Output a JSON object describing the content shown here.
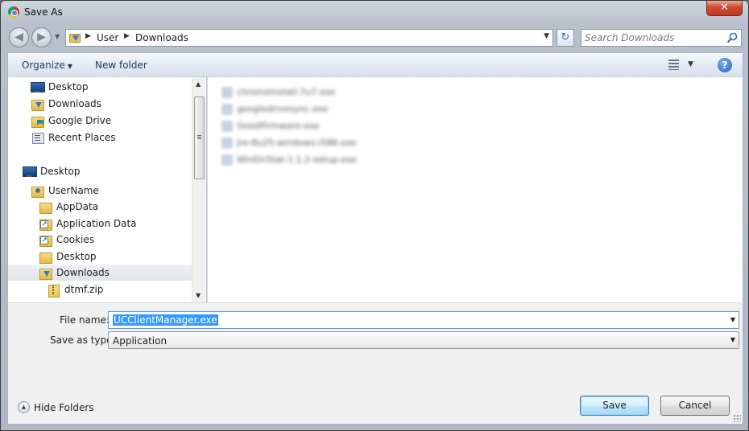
{
  "window": {
    "title": "Save As",
    "close_label": "✕"
  },
  "nav": {
    "back_icon": "back-arrow-icon",
    "forward_icon": "forward-arrow-icon",
    "breadcrumbs": [
      "User",
      "Downloads"
    ],
    "search_placeholder": "Search Downloads"
  },
  "commandbar": {
    "organize": "Organize",
    "new_folder": "New folder"
  },
  "sidebar": {
    "items": [
      {
        "label": "Desktop",
        "icon": "desktop-icon"
      },
      {
        "label": "Downloads",
        "icon": "downloads-folder-icon"
      },
      {
        "label": "Google Drive",
        "icon": "google-drive-icon"
      },
      {
        "label": "Recent Places",
        "icon": "recent-places-icon"
      },
      {
        "label": "Desktop",
        "icon": "desktop-icon"
      },
      {
        "label": "UserName",
        "icon": "user-folder-icon"
      },
      {
        "label": "AppData",
        "icon": "folder-icon"
      },
      {
        "label": "Application Data",
        "icon": "shortcut-folder-icon"
      },
      {
        "label": "Cookies",
        "icon": "shortcut-folder-icon"
      },
      {
        "label": "Desktop",
        "icon": "folder-icon"
      },
      {
        "label": "Downloads",
        "icon": "downloads-folder-icon",
        "selected": true
      },
      {
        "label": "dtmf.zip",
        "icon": "zip-icon"
      }
    ]
  },
  "files": [
    {
      "name": "chromeinstall-7u7.exe"
    },
    {
      "name": "googledrivesync.exe"
    },
    {
      "name": "GoodFirmware.exe"
    },
    {
      "name": "jre-8u25-windows-i586.exe"
    },
    {
      "name": "WinDirStat-1.1.2-setup.exe"
    }
  ],
  "form": {
    "file_name_label": "File name:",
    "file_name_value": "UCClientManager.exe",
    "save_type_label": "Save as type:",
    "save_type_value": "Application"
  },
  "footer": {
    "hide_folders": "Hide Folders",
    "save": "Save",
    "cancel": "Cancel"
  },
  "colors": {
    "selection": "#3399ff",
    "accent": "#1e395b",
    "close": "#c23b22"
  }
}
